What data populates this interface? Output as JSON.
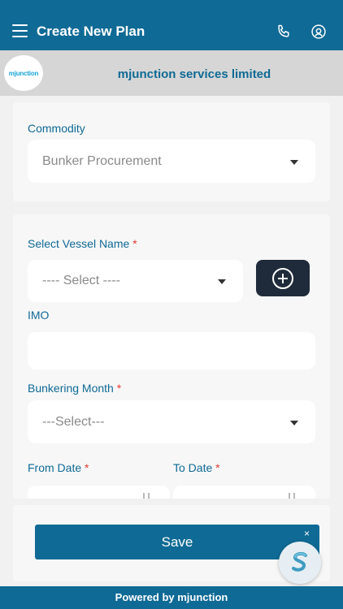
{
  "header": {
    "title": "Create New Plan"
  },
  "company": {
    "name": "mjunction services limited",
    "logo_text": "mjunction"
  },
  "commodity": {
    "label": "Commodity",
    "value": "Bunker Procurement"
  },
  "vessel": {
    "label": "Select Vessel Name",
    "required": "*",
    "value": "---- Select ----"
  },
  "imo": {
    "label": "IMO",
    "value": ""
  },
  "bunkering_month": {
    "label": "Bunkering Month",
    "required": "*",
    "value": "---Select---"
  },
  "from_date": {
    "label": "From Date",
    "required": "*"
  },
  "to_date": {
    "label": "To Date",
    "required": "*"
  },
  "actions": {
    "save_label": "Save",
    "close_label": "×"
  },
  "footer": {
    "text": "Powered by mjunction"
  },
  "colors": {
    "primary": "#0f6a95",
    "dark_button": "#1f2b3a",
    "required": "#e53935"
  }
}
